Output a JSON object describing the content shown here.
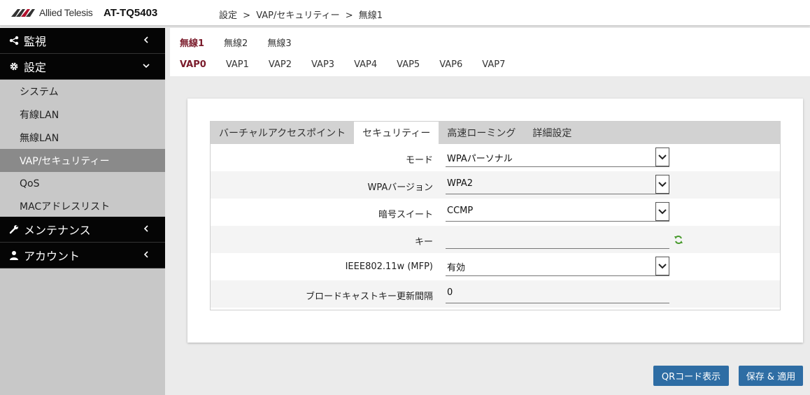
{
  "header": {
    "logo_text": "Allied Telesis",
    "model": "AT-TQ5403",
    "breadcrumb": [
      "設定",
      ">",
      "VAP/セキュリティー",
      ">",
      "無線1"
    ]
  },
  "sidebar": {
    "groups": [
      {
        "label": "監視",
        "icon": "share-icon"
      },
      {
        "label": "設定",
        "icon": "gear-icon"
      },
      {
        "label": "メンテナンス",
        "icon": "wrench-icon"
      },
      {
        "label": "アカウント",
        "icon": "user-icon"
      }
    ],
    "items": [
      "システム",
      "有線LAN",
      "無線LAN",
      "VAP/セキュリティー",
      "QoS",
      "MACアドレスリスト"
    ],
    "active_item": "VAP/セキュリティー"
  },
  "radio_tabs": [
    "無線1",
    "無線2",
    "無線3"
  ],
  "vap_tabs": [
    "VAP0",
    "VAP1",
    "VAP2",
    "VAP3",
    "VAP4",
    "VAP5",
    "VAP6",
    "VAP7"
  ],
  "inner_tabs": [
    "バーチャルアクセスポイント",
    "セキュリティー",
    "高速ローミング",
    "詳細設定"
  ],
  "form": {
    "mode": {
      "label": "モード",
      "value": "WPAパーソナル"
    },
    "wpa_version": {
      "label": "WPAバージョン",
      "value": "WPA2"
    },
    "cipher": {
      "label": "暗号スイート",
      "value": "CCMP"
    },
    "key": {
      "label": "キー",
      "value": ""
    },
    "mfp": {
      "label": "IEEE802.11w (MFP)",
      "value": "有効"
    },
    "rekey": {
      "label": "ブロードキャストキー更新間隔",
      "value": "0"
    }
  },
  "buttons": {
    "qr": "QRコード表示",
    "save": "保存 & 適用"
  },
  "colors": {
    "accent": "#7a1b2b",
    "button": "#2e6da4",
    "sidebar_dark": "#050505",
    "sidebar_active": "#8a8a8a"
  }
}
